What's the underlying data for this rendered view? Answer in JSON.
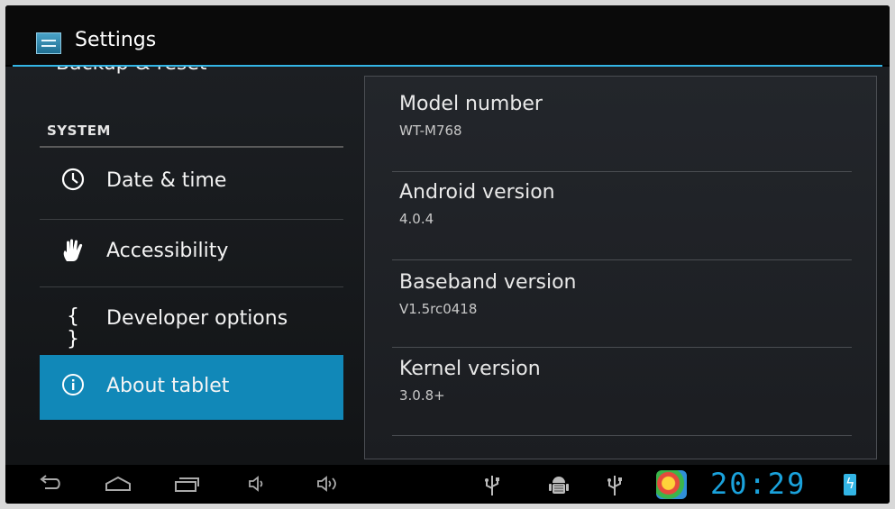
{
  "action_bar": {
    "title": "Settings",
    "app_icon": "settings-icon"
  },
  "left_pane": {
    "partial_item": {
      "label": "Backup & reset",
      "icon": "backup-icon"
    },
    "section_header": "SYSTEM",
    "items": [
      {
        "label": "Date & time",
        "icon": "clock-icon",
        "selected": false
      },
      {
        "label": "Accessibility",
        "icon": "hand-icon",
        "selected": false
      },
      {
        "label": "Developer options",
        "icon": "braces-icon",
        "glyph": "{ }",
        "selected": false
      },
      {
        "label": "About tablet",
        "icon": "info-icon",
        "selected": true
      }
    ]
  },
  "about": {
    "rows": [
      {
        "name": "Model number",
        "value": "WT-M768"
      },
      {
        "name": "Android version",
        "value": "4.0.4"
      },
      {
        "name": "Baseband version",
        "value": "V1.5rc0418"
      },
      {
        "name": "Kernel version",
        "value": "3.0.8+"
      }
    ]
  },
  "system_bar": {
    "clock": "20:29",
    "icons": [
      "back-icon",
      "home-icon",
      "recent-apps-icon",
      "volume-down-icon",
      "volume-up-icon",
      "usb-icon",
      "android-debug-icon",
      "usb-icon",
      "game-app-icon",
      "battery-charging-icon"
    ]
  },
  "colors": {
    "accent": "#33b5e5",
    "selected_bg": "#1188b8",
    "clock": "#1aa2dc"
  }
}
